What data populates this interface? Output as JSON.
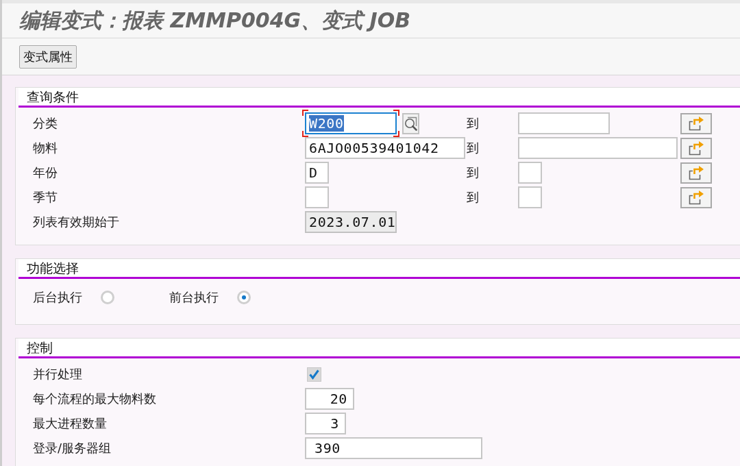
{
  "title": "编辑变式：报表 ZMMP004G、变式 JOB",
  "toolbar": {
    "buttons": [
      "变式属性"
    ]
  },
  "sections": [
    {
      "title": "查询条件",
      "rows": [
        {
          "kind": "range",
          "label": "分类",
          "value": "W200",
          "focused": true,
          "to_label": "到"
        },
        {
          "kind": "range",
          "label": "物料",
          "value": "6AJO00539401042",
          "focused": false,
          "to_label": "到"
        },
        {
          "kind": "range",
          "label": "年份",
          "value": "D",
          "focused": false,
          "to_label": "到"
        },
        {
          "kind": "range",
          "label": "季节",
          "focused": false,
          "to_label": "到"
        },
        {
          "kind": "display",
          "label": "列表有效期始于",
          "value": "2023.07.01"
        }
      ]
    },
    {
      "title": "功能选择",
      "rows": [
        {
          "kind": "radios",
          "options": [
            {
              "label": "后台执行",
              "selected": false
            },
            {
              "label": "前台执行",
              "selected": true
            }
          ]
        }
      ]
    },
    {
      "title": "控制",
      "rows": [
        {
          "kind": "checkbox",
          "label": "并行处理",
          "checked": true
        },
        {
          "kind": "number",
          "label": "每个流程的最大物料数",
          "value": "20"
        },
        {
          "kind": "number",
          "label": "最大进程数量",
          "value": "3"
        },
        {
          "kind": "text",
          "label": "登录/服务器组",
          "value": "390"
        }
      ]
    }
  ]
}
